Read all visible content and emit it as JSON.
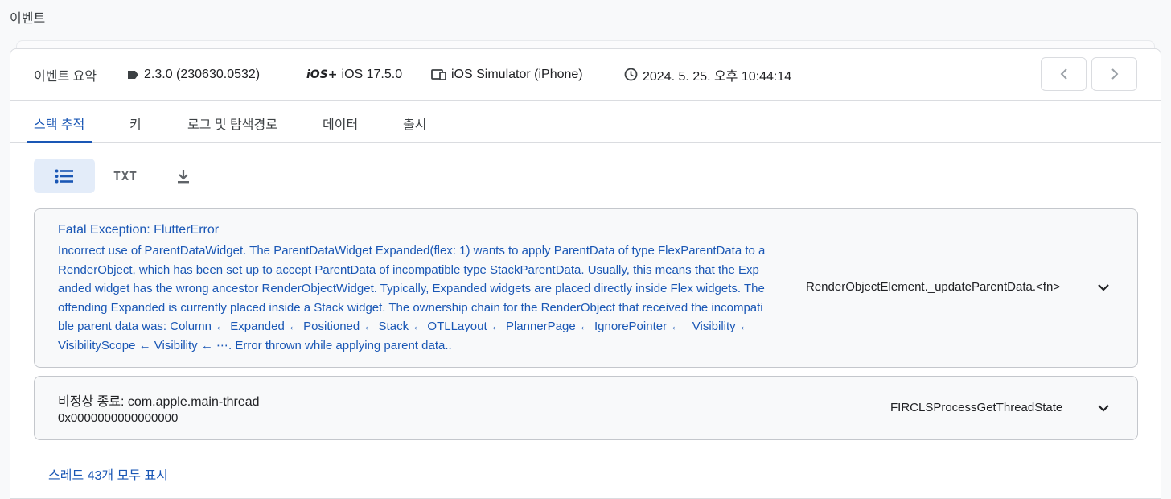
{
  "page": {
    "label": "이벤트"
  },
  "summary": {
    "label": "이벤트 요약",
    "version": "2.3.0 (230630.0532)",
    "os": "iOS 17.5.0",
    "device": "iOS Simulator (iPhone)",
    "timestamp": "2024. 5. 25. 오후 10:44:14",
    "os_icon_text": "iOS+"
  },
  "tabs": [
    {
      "label": "스택 추적"
    },
    {
      "label": "키"
    },
    {
      "label": "로그 및 탐색경로"
    },
    {
      "label": "데이터"
    },
    {
      "label": "출시"
    }
  ],
  "toolbar": {
    "txt_label": "TXT"
  },
  "frames": [
    {
      "title": "Fatal Exception: FlutterError",
      "body": "Incorrect use of ParentDataWidget. The ParentDataWidget Expanded(flex: 1) wants to apply ParentData of type FlexParentData to a RenderObject, which has been set up to accept ParentData of incompatible type StackParentData. Usually, this means that the Expanded widget has the wrong ancestor RenderObjectWidget. Typically, Expanded widgets are placed directly inside Flex widgets. The offending Expanded is currently placed inside a Stack widget. The ownership chain for the RenderObject that received the incompatible parent data was: Column ← Expanded ← Positioned ← Stack ← OTLLayout ← PlannerPage ← IgnorePointer ← _Visibility ← _VisibilityScope ← Visibility ← ⋯. Error thrown while applying parent data..",
      "function": "RenderObjectElement._updateParentData.<fn>"
    },
    {
      "title": "비정상 종료: com.apple.main-thread",
      "body": "0x0000000000000000",
      "function": "FIRCLSProcessGetThreadState"
    }
  ],
  "show_all": "스레드 43개 모두 표시",
  "colors": {
    "accent": "#1a57b5",
    "active_bg": "#e3ecf9",
    "border": "#dadce0"
  }
}
